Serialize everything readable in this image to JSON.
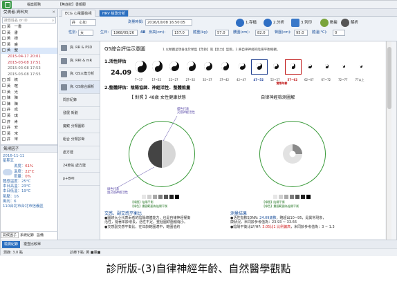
{
  "topbar": {
    "menu_file": "檔案服務",
    "menu_more": "【無症狀】書報服"
  },
  "left": {
    "header": "受測者-資料夾",
    "search_placeholder": "搜尋姓名 or ID",
    "patients": [
      {
        "label": "黃　一書",
        "type": "patient"
      },
      {
        "label": "黃　書",
        "type": "patient"
      },
      {
        "label": "黃　德",
        "type": "patient"
      },
      {
        "label": "黃　盛",
        "type": "patient"
      },
      {
        "label": "黃　聖",
        "type": "patient",
        "selected": true
      },
      {
        "label": "2015-04-17 20:01",
        "type": "record",
        "highlight": true
      },
      {
        "label": "2015-03-08 17:51",
        "type": "record",
        "highlight": true
      },
      {
        "label": "2015-03-08 17:53",
        "type": "record"
      },
      {
        "label": "2015-03-08 17:55",
        "type": "record"
      },
      {
        "label": "郭　統",
        "type": "patient"
      },
      {
        "label": "黃　暄",
        "type": "patient"
      },
      {
        "label": "黃　光",
        "type": "patient"
      },
      {
        "label": "陳　陳",
        "type": "patient"
      },
      {
        "label": "陳　陳",
        "type": "patient"
      },
      {
        "label": "許　成",
        "type": "patient"
      },
      {
        "label": "黃　琪",
        "type": "patient"
      },
      {
        "label": "許　肯",
        "type": "patient"
      },
      {
        "label": "許　安",
        "type": "patient"
      },
      {
        "label": "黃　宋",
        "type": "patient"
      },
      {
        "label": "許　宋",
        "type": "patient"
      }
    ],
    "frame2_header": "氣候因子",
    "weather": {
      "date": "2016-11-11",
      "weekday": "星期五",
      "place": "我的所在",
      "humidity_label": "濕度：",
      "humidity": "61%",
      "temp_label": "溫度：",
      "temp": "22°C",
      "rain_label": "雨量：",
      "rain": "0%",
      "lines": [
        "體感溫度：25°C",
        "本日高溫：23°C",
        "本日低溫：19°C",
        "氣壓：16",
        "風向：6"
      ],
      "station": "110台北市台北市信義區"
    },
    "tabs": [
      "氣候因子",
      "系統紀錄",
      "設備"
    ]
  },
  "tabs": [
    {
      "label": "ECG 心電圖檢視",
      "active": false
    },
    {
      "label": "HRV 檢測分析",
      "active": true
    }
  ],
  "toolbar": {
    "name_label": "許",
    "name_value": "心如",
    "time_label": "測量時間:",
    "time_value": "2016/10/08 16:50:05",
    "sex_label": "性別:",
    "sex_value": "女",
    "birth_label": "生日:",
    "birth_value": "1968/05/26",
    "age": "48",
    "height_label": "身高(cm):",
    "height": "157.0",
    "weight_label": "體重(kg):",
    "weight": "57.0",
    "waist_label": "腰圍(cm):",
    "waist": "82.0",
    "hip_label": "臀圍(cm):",
    "hip": "95.0",
    "temp_label": "體溫(°C):",
    "temp": "0",
    "btn_save": "1.存檔",
    "btn_analyze": "2.分析",
    "btn_print": "3.列印",
    "btn_data": "數據",
    "btn_explain": "解析"
  },
  "nav": [
    "資. RR & PSD",
    "資. RRI & mR",
    "資. QS三角分析",
    "資. Q5綜合解析",
    "問診紀錄",
    "發展 新劃",
    "魔鏡 分類圖影",
    "組合 分類診斷",
    "處方建",
    "24節氣 處方建",
    "p+BMI"
  ],
  "report": {
    "title": "Q5綜合評估示意圖",
    "subtitle": "1.以類圖呈現各生於類型【年齡】就【氣力】型態，2.將自律神經的陰陽平衡概觀。",
    "sec1": "1.活性評估",
    "age_value": "24.09",
    "scale": [
      "7~17",
      "17~22",
      "22~27",
      "27~32",
      "32~37",
      "37~42",
      "42~47",
      "47~52",
      "52~57",
      "57~62",
      "62~67",
      "67~72",
      "72~77",
      "77以上"
    ],
    "actual_label": "實際年齡",
    "sec2": "2.整體評估：陰陽協調．神經活性．整體能量",
    "left_chart_title": "【 對照 】48歲 女性健康狀態",
    "right_chart_title": "自律神經檢測圖解",
    "annot_top": [
      "僅色代表",
      "交感神經活性"
    ],
    "annot_bottom": [
      "綠色代表",
      "副交感神經活性"
    ],
    "legend_text": "【綠圈】陰陽平衡",
    "legend_sub": "【綠色】畫圓範圍為陰陽平衡",
    "note_left_title": "交感、副交感平衡比",
    "note_left": [
      "●圖餅大小代表兩者的陰陽總體能力，也是自律神經權衡",
      "活性，隨著年齡增長，活性不足，整個圖餅面積縮小。",
      "●交感副交感平衡比，在年齡範圍適中，範圍值約"
    ],
    "note_right_title": "測量結果",
    "note_right_1": "●活性指數SDNN: ",
    "note_right_1b": "24.09歲數",
    "note_right_1c": "，略超出10~95，是異常現象，",
    "note_right_2": "康狀況，米同齡參考值為：23.93 ~ 33.66",
    "note_right_3": "●陰陽平衡比LF/HF: ",
    "note_right_3b": "3.05比1 比例偏高",
    "note_right_3c": "，米同齡參考值為：3 ~ 1.3"
  },
  "status_tabs": [
    "檢測紀錄",
    "複查比較單"
  ],
  "statusbar": {
    "left": "測錄: 3.0 點",
    "right": "診療下點: 黃 ■量■"
  },
  "caption": "診所版-(3)自律神經年齡、自然醫學觀點"
}
